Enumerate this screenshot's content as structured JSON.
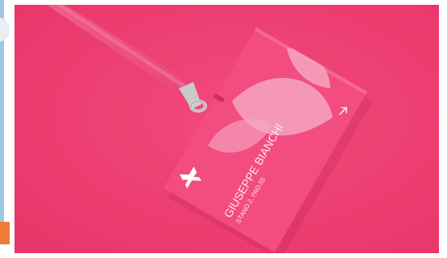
{
  "badge": {
    "name": "GIUSEPPE BIANCHI",
    "location": "STAND 2, PAD.55"
  },
  "icons": {
    "arrow": "arrow-up-right-icon",
    "logo": "brand-logo-icon"
  },
  "colors": {
    "background": "#ee3e73",
    "badge": "#f24c80",
    "lanyard": "#f04c7e",
    "leaves": "#f6a6c2"
  }
}
